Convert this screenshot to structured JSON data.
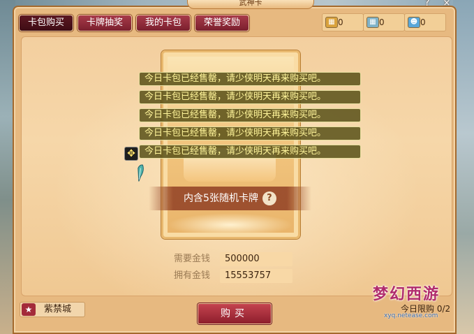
{
  "window": {
    "title": "武神卡",
    "help_label": "?",
    "close_label": "×"
  },
  "tabs": [
    {
      "label": "卡包购买",
      "active": true
    },
    {
      "label": "卡牌抽奖",
      "active": false
    },
    {
      "label": "我的卡包",
      "active": false
    },
    {
      "label": "荣誉奖励",
      "active": false
    }
  ],
  "currencies": [
    {
      "icon": "gold-card-icon",
      "value": "0",
      "color": "#d9a23c"
    },
    {
      "icon": "silver-card-icon",
      "value": "0",
      "color": "#7fb2c8"
    },
    {
      "icon": "blue-card-icon",
      "value": "0",
      "color": "#5aa7d8"
    }
  ],
  "card": {
    "banner": "内含5张随机卡牌",
    "help_label": "?"
  },
  "messages": [
    "今日卡包已经售罄，请少侠明天再来购买吧。",
    "今日卡包已经售罄，请少侠明天再来购买吧。",
    "今日卡包已经售罄，请少侠明天再来购买吧。",
    "今日卡包已经售罄，请少侠明天再来购买吧。",
    "今日卡包已经售罄，请少侠明天再来购买吧。"
  ],
  "price": {
    "required_label": "需要金钱",
    "required_value": "500000",
    "owned_label": "拥有金钱",
    "owned_value": "15553757"
  },
  "location": {
    "name": "紫禁城"
  },
  "buy_button": {
    "label": "购买"
  },
  "logo": {
    "page_text": "今日限购 0/2",
    "site": "xyq.netease.com"
  },
  "colors": {
    "tab_bg": "#8b2232",
    "message_text": "#fff59a",
    "panel_bg": "#f3cf9f"
  }
}
